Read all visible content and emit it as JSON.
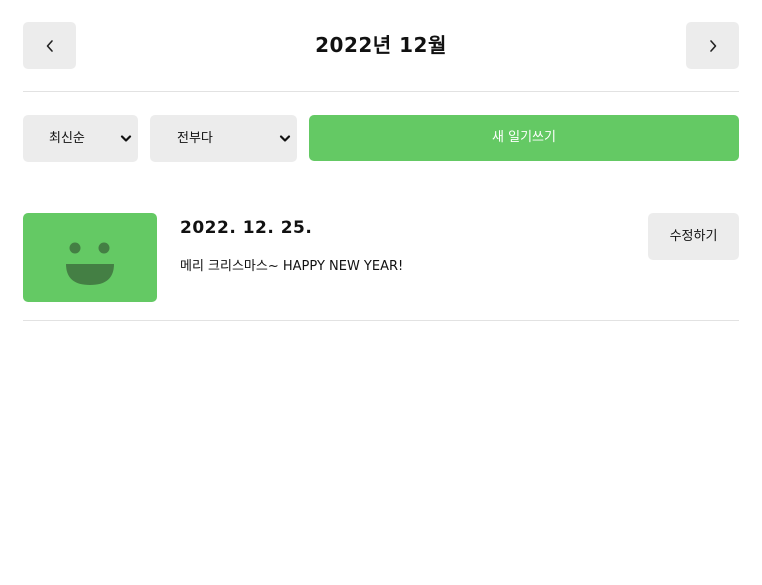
{
  "header": {
    "title": "2022년 12월",
    "prev_icon": "chevron-left-icon",
    "next_icon": "chevron-right-icon"
  },
  "controls": {
    "sort_select": {
      "value": "최신순",
      "icon": "chevron-down-icon"
    },
    "filter_select": {
      "value": "전부다",
      "icon": "chevron-down-icon"
    },
    "new_button_label": "새 일기쓰기"
  },
  "diary_list": {
    "items": [
      {
        "date": "2022. 12. 25.",
        "content": "메리 크리스마스~ HAPPY NEW YEAR!",
        "emotion_icon": "smile-face-icon",
        "emotion_color": "#64c964",
        "edit_label": "수정하기"
      }
    ]
  },
  "colors": {
    "accent": "#64c964",
    "button_bg": "#ececec",
    "divider": "#e2e2e2",
    "face": "#447f44"
  }
}
